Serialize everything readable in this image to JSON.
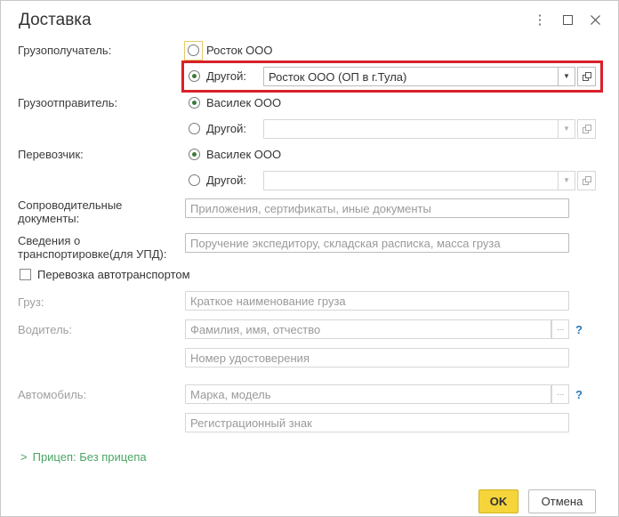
{
  "window": {
    "title": "Доставка",
    "menu_icon": "more-vertical-icon",
    "maximize_icon": "maximize-icon",
    "close_icon": "close-icon"
  },
  "consignee": {
    "label": "Грузополучатель:",
    "option1": "Росток ООО",
    "option2": "Другой:",
    "value": "Росток ООО (ОП в г.Тула)",
    "selected": "option2"
  },
  "shipper": {
    "label": "Грузоотправитель:",
    "option1": "Василек ООО",
    "option2": "Другой:",
    "value": "",
    "selected": "option1"
  },
  "carrier": {
    "label": "Перевозчик:",
    "option1": "Василек ООО",
    "option2": "Другой:",
    "value": "",
    "selected": "option1"
  },
  "documents": {
    "label": "Сопроводительные документы:",
    "placeholder": "Приложения, сертификаты, иные документы"
  },
  "transport_info": {
    "label": "Сведения о транспортировке(для УПД):",
    "placeholder": "Поручение экспедитору, складская расписка, масса груза"
  },
  "auto_transport": {
    "label": "Перевозка автотранспортом",
    "checked": false
  },
  "cargo": {
    "label": "Груз:",
    "placeholder": "Краткое наименование груза"
  },
  "driver": {
    "label": "Водитель:",
    "placeholder": "Фамилия, имя, отчество",
    "license_placeholder": "Номер удостоверения",
    "help": "?"
  },
  "vehicle": {
    "label": "Автомобиль:",
    "placeholder": "Марка, модель",
    "reg_placeholder": "Регистрационный знак",
    "help": "?"
  },
  "trailer": {
    "link": "Прицеп: Без прицепа"
  },
  "buttons": {
    "ok": "OK",
    "cancel": "Отмена"
  }
}
